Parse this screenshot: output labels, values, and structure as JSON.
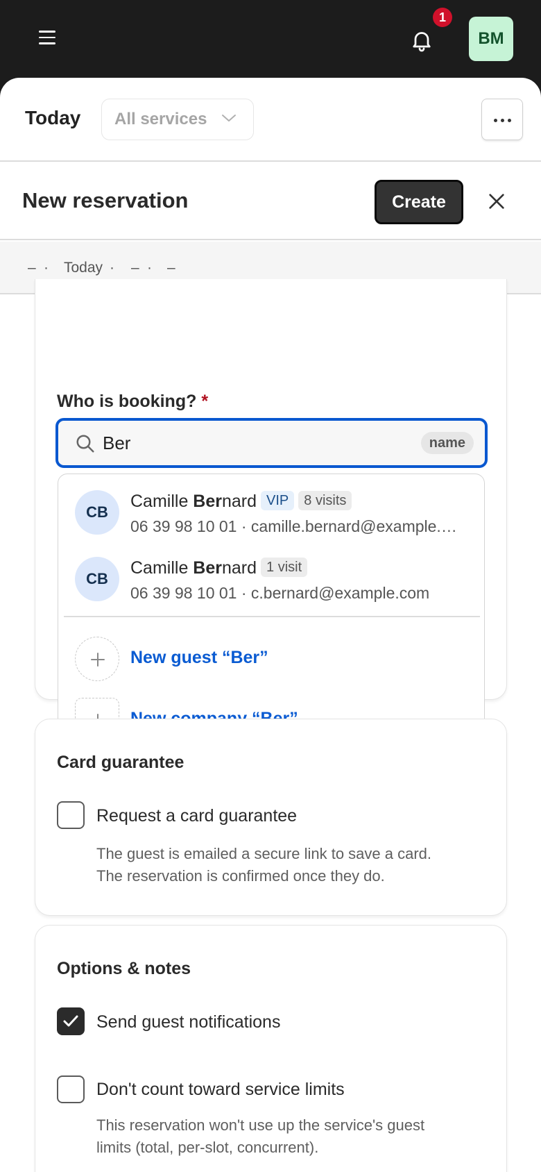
{
  "topbar": {
    "notification_count": "1",
    "user_initials": "BM",
    "icons": [
      "hamburger-icon",
      "bell-icon"
    ]
  },
  "filter": {
    "title": "Today",
    "services": "All services"
  },
  "header": {
    "title": "New reservation",
    "create_label": "Create"
  },
  "summary": [
    "–",
    "·",
    "Today",
    "·",
    "–",
    "·",
    "–"
  ],
  "booking": {
    "label": "Who is booking?",
    "required_mark": "*",
    "search_value": "Ber",
    "search_mode": "name",
    "results": [
      {
        "initials": "CB",
        "name_pre": "Camille ",
        "name_match": "Ber",
        "name_post": "nard",
        "tags": [
          "VIP",
          "8 visits"
        ],
        "contact": "06 39 98 10 01 · camille.bernard@example.…"
      },
      {
        "initials": "CB",
        "name_pre": "Camille ",
        "name_match": "Ber",
        "name_post": "nard",
        "tags": [
          "1 visit"
        ],
        "contact": "06 39 98 10 01 · c.bernard@example.com"
      }
    ],
    "new_guest": "New guest “Ber”",
    "new_company": "New company “Ber”"
  },
  "card_guarantee": {
    "title": "Card guarantee",
    "checkbox_label": "Request a card guarantee",
    "checked": false,
    "help_line1": "The guest is emailed a secure link to save a card.",
    "help_line2": "The reservation is confirmed once they do."
  },
  "options": {
    "title": "Options & notes",
    "notify_label": "Send guest notifications",
    "notify_checked": true,
    "limits_label": "Don't count toward service limits",
    "limits_checked": false,
    "limits_help_line1": "This reservation won't use up the service's guest",
    "limits_help_line2": "limits (total, per-slot, concurrent)."
  },
  "colors": {
    "accent": "#0a58d0",
    "link": "#0a5bd2",
    "badge": "#d0112b",
    "avatar_bg": "#c6f3d6"
  }
}
